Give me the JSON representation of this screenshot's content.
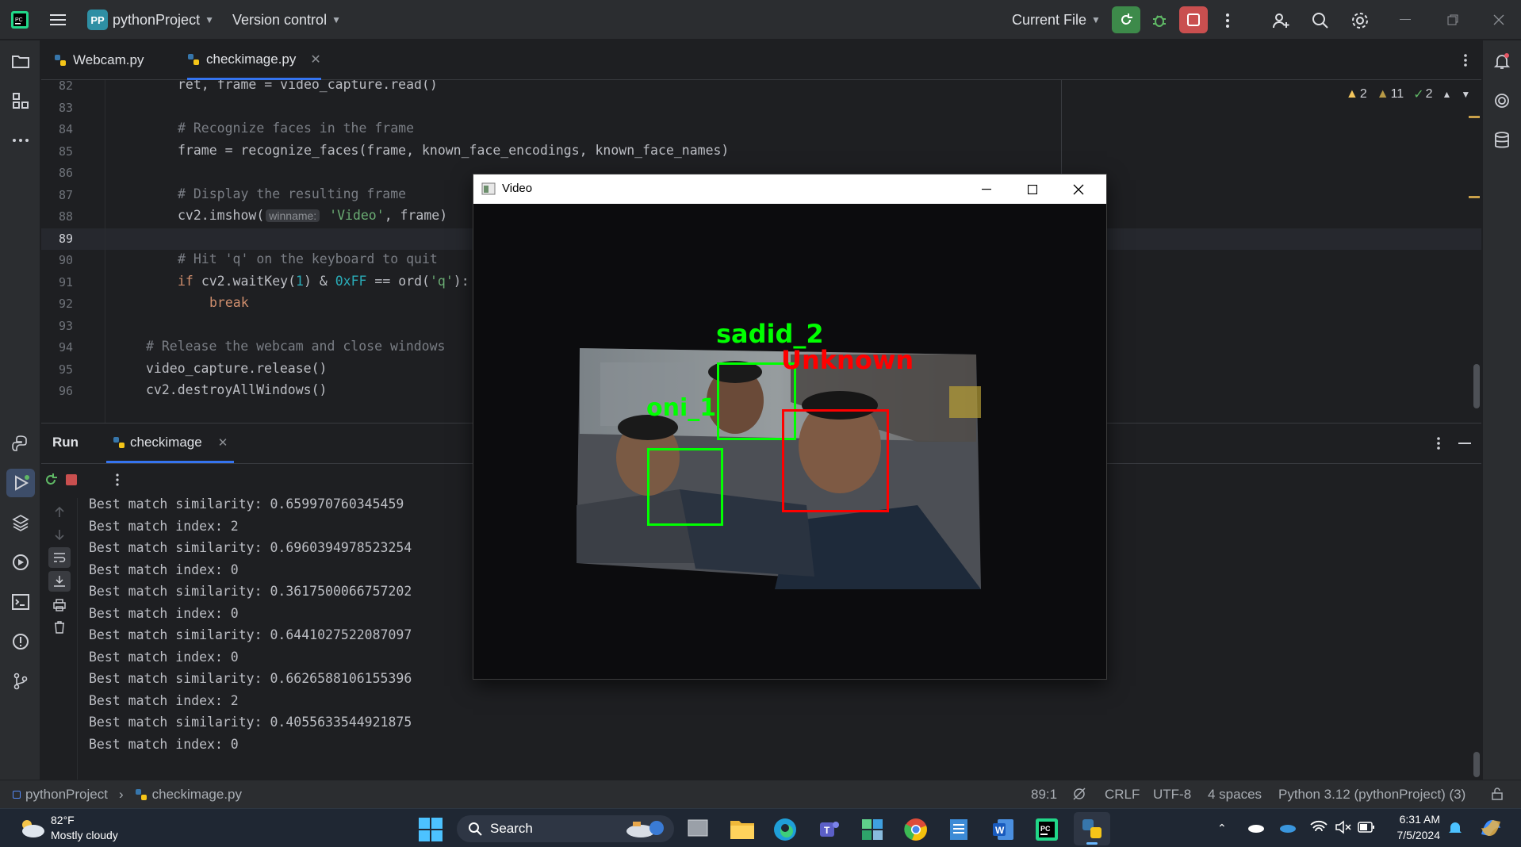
{
  "titlebar": {
    "project_badge": "PP",
    "project_name": "pythonProject",
    "vcs": "Version control",
    "run_config": "Current File"
  },
  "left_toolbar_icons": [
    "folder-icon",
    "structure-icon",
    "more-icon",
    "python-console-icon",
    "run-icon",
    "layers-icon",
    "services-icon",
    "terminal-icon",
    "problems-icon",
    "git-icon"
  ],
  "tabs": [
    {
      "label": "Webcam.py"
    },
    {
      "label": "checkimage.py"
    }
  ],
  "inspections": {
    "warn_a": "2",
    "warn_b": "11",
    "ok": "2"
  },
  "editor": {
    "lines": [
      {
        "n": "82",
        "indent": 2,
        "parts": [
          {
            "t": "ret, frame = video_capture.read()",
            "c": ""
          }
        ]
      },
      {
        "n": "83",
        "indent": 0,
        "parts": []
      },
      {
        "n": "84",
        "indent": 2,
        "parts": [
          {
            "t": "# Recognize faces in the frame",
            "c": "cm"
          }
        ]
      },
      {
        "n": "85",
        "indent": 2,
        "parts": [
          {
            "t": "frame = recognize_faces(frame, known_face_encodings, known_face_names)",
            "c": ""
          }
        ]
      },
      {
        "n": "86",
        "indent": 0,
        "parts": []
      },
      {
        "n": "87",
        "indent": 2,
        "parts": [
          {
            "t": "# Display the resulting frame",
            "c": "cm"
          }
        ]
      },
      {
        "n": "88",
        "indent": 2,
        "parts": [
          {
            "t": "cv2.imshow(",
            "c": ""
          },
          {
            "t": "winname:",
            "c": "hint"
          },
          {
            "t": " 'Video'",
            "c": "str"
          },
          {
            "t": ", frame)",
            "c": ""
          }
        ]
      },
      {
        "n": "89",
        "indent": 0,
        "parts": []
      },
      {
        "n": "90",
        "indent": 2,
        "parts": [
          {
            "t": "# Hit 'q' on the keyboard to quit",
            "c": "cm"
          }
        ]
      },
      {
        "n": "91",
        "indent": 2,
        "parts": [
          {
            "t": "if ",
            "c": "kw"
          },
          {
            "t": "cv2.waitKey(",
            "c": ""
          },
          {
            "t": "1",
            "c": "num"
          },
          {
            "t": ") & ",
            "c": ""
          },
          {
            "t": "0xFF",
            "c": "num"
          },
          {
            "t": " == ord(",
            "c": ""
          },
          {
            "t": "'q'",
            "c": "str"
          },
          {
            "t": "):",
            "c": ""
          }
        ]
      },
      {
        "n": "92",
        "indent": 3,
        "parts": [
          {
            "t": "break",
            "c": "kw"
          }
        ]
      },
      {
        "n": "93",
        "indent": 0,
        "parts": []
      },
      {
        "n": "94",
        "indent": 1,
        "parts": [
          {
            "t": "# Release the webcam and close windows",
            "c": "cm"
          }
        ]
      },
      {
        "n": "95",
        "indent": 1,
        "parts": [
          {
            "t": "video_capture.release()",
            "c": ""
          }
        ]
      },
      {
        "n": "96",
        "indent": 1,
        "parts": [
          {
            "t": "cv2.destroyAllWindows()",
            "c": ""
          }
        ]
      }
    ]
  },
  "run_panel": {
    "title": "Run",
    "tab": "checkimage",
    "console": [
      "Best match similarity: 0.659970760345459",
      "Best match index: 2",
      "Best match similarity: 0.6960394978523254",
      "Best match index: 0",
      "Best match similarity: 0.3617500066757202",
      "Best match index: 0",
      "Best match similarity: 0.6441027522087097",
      "Best match index: 0",
      "Best match similarity: 0.6626588106155396",
      "Best match index: 2",
      "Best match similarity: 0.4055633544921875",
      "Best match index: 0"
    ]
  },
  "video_window": {
    "title": "Video",
    "faces": [
      {
        "label": "sadid_2",
        "color": "#00ff00"
      },
      {
        "label": "Unknown",
        "color": "#ff0000"
      },
      {
        "label": "oni_1",
        "color": "#00ff00"
      }
    ]
  },
  "statusbar": {
    "crumb_project": "pythonProject",
    "crumb_file": "checkimage.py",
    "position": "89:1",
    "line_sep": "CRLF",
    "encoding": "UTF-8",
    "indent": "4 spaces",
    "interpreter": "Python 3.12 (pythonProject) (3)"
  },
  "taskbar": {
    "temp": "82°F",
    "weather": "Mostly cloudy",
    "search": "Search",
    "time": "6:31 AM",
    "date": "7/5/2024"
  }
}
